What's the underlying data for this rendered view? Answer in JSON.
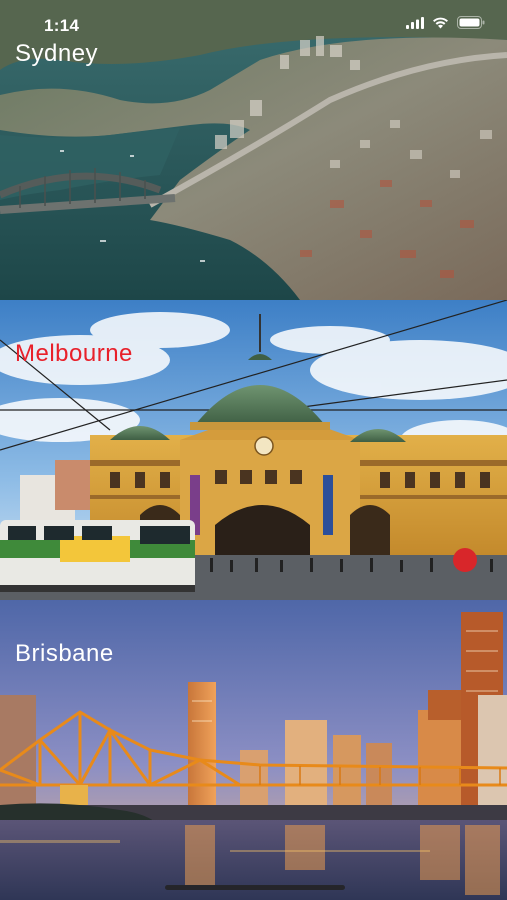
{
  "status_bar": {
    "time": "1:14"
  },
  "cities": [
    {
      "name": "Sydney",
      "label_color": "#ffffff"
    },
    {
      "name": "Melbourne",
      "label_color": "#e8202a"
    },
    {
      "name": "Brisbane",
      "label_color": "#ffffff"
    }
  ]
}
